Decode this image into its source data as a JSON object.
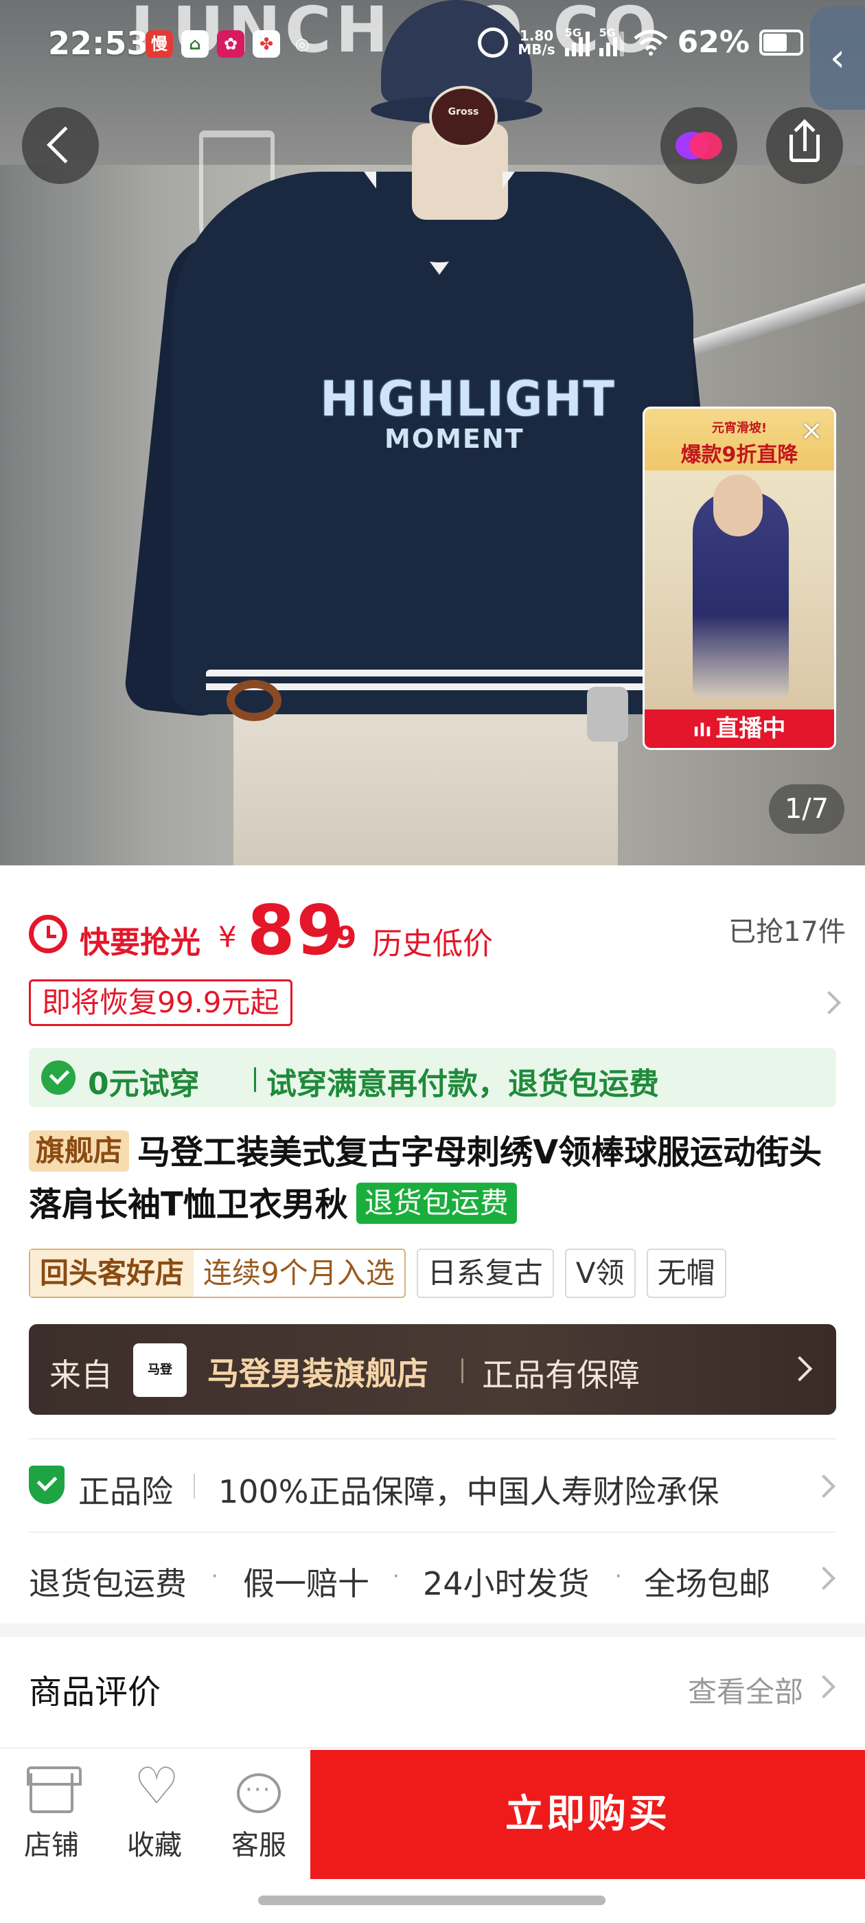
{
  "status_bar": {
    "time": "22:53",
    "speed": "1.80\nMB/s",
    "net1": "5G",
    "net2": "5G",
    "battery": "62%"
  },
  "hero": {
    "bg_sign": "LUNCH CO  CO",
    "cap_badge": "Gross",
    "shirt_line1": "HIGHLIGHT",
    "shirt_line2": "MOMENT",
    "page_indicator": "1/7",
    "live": {
      "banner_line1": "元宵滑坡!",
      "banner_line2": "爆款9折直降",
      "footer": "直播中"
    }
  },
  "price": {
    "rush_label": "快要抢光",
    "currency": "¥",
    "integer": "89",
    "decimal": ".9",
    "history_low": "历史低价",
    "sold": "已抢17件",
    "restore": "即将恢复99.9元起"
  },
  "tryon": {
    "lead": "0元试穿",
    "detail": "试穿满意再付款，退货包运费"
  },
  "product": {
    "flagship_tag": "旗舰店",
    "title": "马登工装美式复古字母刺绣V领棒球服运动街头落肩长袖T恤卫衣男秋",
    "return_tag": "退货包运费"
  },
  "tags": {
    "gold_a": "回头客好店",
    "gold_b": "连续9个月入选",
    "items": [
      "日系复古",
      "V领",
      "无帽"
    ]
  },
  "store": {
    "from": "来自",
    "logo_text": "马登",
    "name": "马登男装旗舰店",
    "guarantee": "正品有保障"
  },
  "insurance": {
    "label": "正品险",
    "detail": "100%正品保障，中国人寿财险承保"
  },
  "services": [
    "退货包运费",
    "假一赔十",
    "24小时发货",
    "全场包邮"
  ],
  "reviews": {
    "heading": "商品评价",
    "view_all": "查看全部"
  },
  "bottom_bar": {
    "store": "店铺",
    "favorite": "收藏",
    "service": "客服",
    "buy": "立即购买"
  },
  "colors": {
    "accent_red": "#e4162a",
    "buy_red": "#ef1b1b",
    "green": "#1f8a3a"
  }
}
